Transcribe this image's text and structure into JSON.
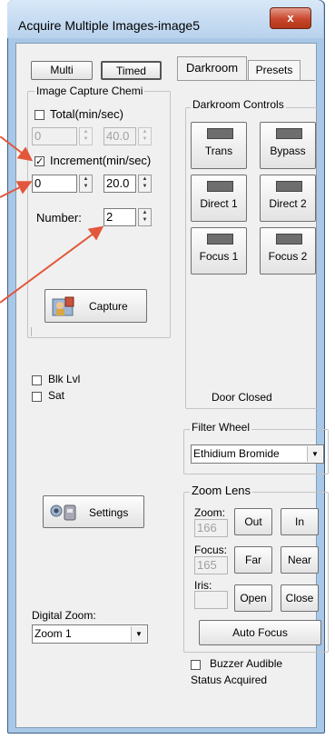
{
  "window": {
    "title": "Acquire Multiple Images-image5",
    "close_label": "x"
  },
  "mode_buttons": {
    "multi": "Multi",
    "timed": "Timed"
  },
  "capture_group": {
    "label": "Image Capture Chemi",
    "total": {
      "label": "Total(min/sec)",
      "checked": false,
      "value1": "0",
      "value2": "40.0"
    },
    "increment": {
      "label": "Increment(min/sec)",
      "checked": true,
      "value1": "0",
      "value2": "20.0"
    },
    "number": {
      "label": "Number:",
      "value": "2"
    },
    "capture_button": "Capture"
  },
  "left_checks": {
    "blk_lvl": "Blk Lvl",
    "sat": "Sat"
  },
  "settings_button": "Settings",
  "digital_zoom": {
    "label": "Digital Zoom:",
    "value": "Zoom 1"
  },
  "tabs": [
    {
      "label": "Darkroom"
    },
    {
      "label": "Presets"
    }
  ],
  "darkroom": {
    "label": "Darkroom Controls",
    "buttons": [
      {
        "label": "Trans"
      },
      {
        "label": "Bypass"
      },
      {
        "label": "Direct 1"
      },
      {
        "label": "Direct 2"
      },
      {
        "label": "Focus 1"
      },
      {
        "label": "Focus 2"
      }
    ],
    "door_status": "Door Closed"
  },
  "filter_wheel": {
    "label": "Filter Wheel",
    "value": "Ethidium Bromide"
  },
  "zoom_lens": {
    "label": "Zoom Lens",
    "zoom": {
      "label": "Zoom:",
      "value": "166",
      "btn_out": "Out",
      "btn_in": "In"
    },
    "focus": {
      "label": "Focus:",
      "value": "165",
      "btn_far": "Far",
      "btn_near": "Near"
    },
    "iris": {
      "label": "Iris:",
      "value": "",
      "btn_open": "Open",
      "btn_close": "Close"
    },
    "auto_focus": "Auto Focus"
  },
  "buzzer": {
    "label": "Buzzer Audible",
    "checked": false
  },
  "status": "Status Acquired",
  "colors": {
    "annotation_arrow": "#e2573b",
    "title_bar": "#b8d2ec",
    "close_button": "#c9462c"
  },
  "icons": {
    "capture": "capture-camera-icon",
    "settings": "settings-camera-icon"
  }
}
